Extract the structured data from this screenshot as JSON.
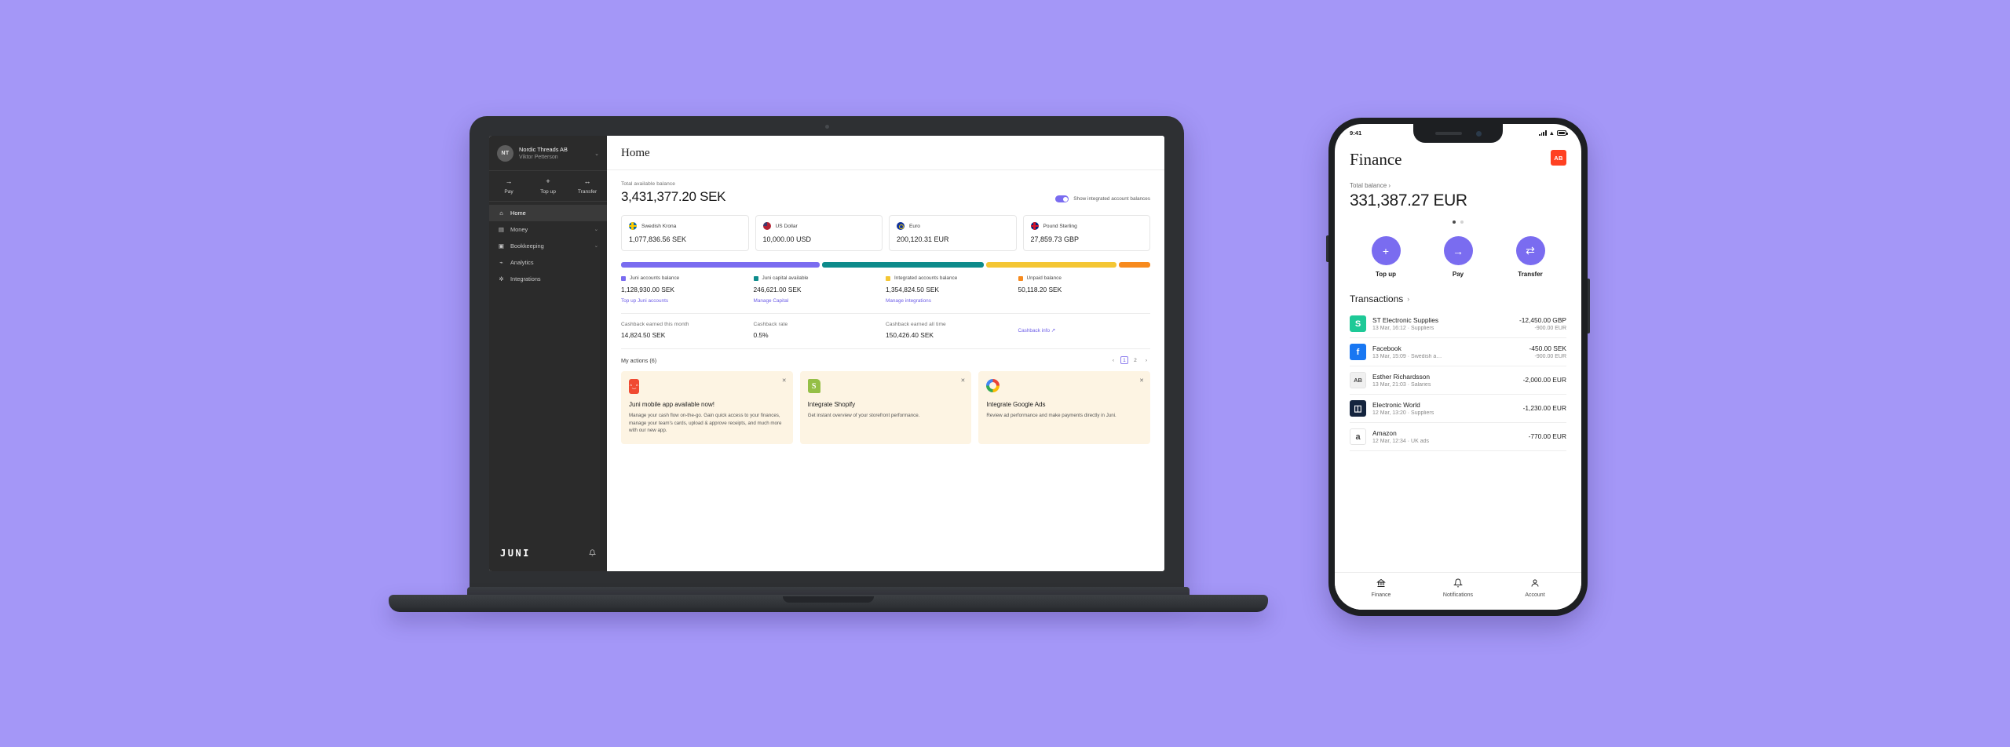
{
  "desktop": {
    "sidebar": {
      "org_initials": "NT",
      "org_name": "Nordic Threads AB",
      "user_name": "Viktor Petterson",
      "chevron": "⌄",
      "quick_actions": [
        {
          "icon": "→",
          "label": "Pay"
        },
        {
          "icon": "+",
          "label": "Top up"
        },
        {
          "icon": "↔",
          "label": "Transfer"
        }
      ],
      "nav": [
        {
          "icon": "⌂",
          "label": "Home",
          "active": true,
          "chevron": ""
        },
        {
          "icon": "▤",
          "label": "Money",
          "active": false,
          "chevron": "⌄"
        },
        {
          "icon": "▣",
          "label": "Bookkeeping",
          "active": false,
          "chevron": "⌄"
        },
        {
          "icon": "⌁",
          "label": "Analytics",
          "active": false,
          "chevron": ""
        },
        {
          "icon": "✲",
          "label": "Integrations",
          "active": false,
          "chevron": ""
        }
      ],
      "logo": "JUNI",
      "bell": "🔔"
    },
    "header": {
      "title": "Home"
    },
    "balance": {
      "label": "Total available balance",
      "amount": "3,431,377.20 SEK",
      "toggle_label": "Show integrated account balances",
      "toggle_on": true
    },
    "currencies": [
      {
        "flag": "se",
        "name": "Swedish Krona",
        "amount": "1,077,836.56 SEK"
      },
      {
        "flag": "us",
        "name": "US Dollar",
        "amount": "10,000.00 USD"
      },
      {
        "flag": "eu",
        "name": "Euro",
        "amount": "200,120.31 EUR"
      },
      {
        "flag": "gb",
        "name": "Pound Sterling",
        "amount": "27,859.73 GBP"
      }
    ],
    "breakdown": [
      {
        "label": "Juni accounts balance",
        "amount": "1,128,930.00 SEK",
        "link": "Top up Juni accounts",
        "color": "#7a6cf0",
        "weight": 38
      },
      {
        "label": "Juni capital available",
        "amount": "246,621.00 SEK",
        "link": "Manage Capital",
        "color": "#0d8b8b",
        "weight": 31
      },
      {
        "label": "Integrated accounts balance",
        "amount": "1,354,824.50 SEK",
        "link": "Manage integrations",
        "color": "#f4c634",
        "weight": 25
      },
      {
        "label": "Unpaid balance",
        "amount": "50,118.20 SEK",
        "link": "",
        "color": "#f78a1e",
        "weight": 6
      }
    ],
    "cashback": {
      "items": [
        {
          "label": "Cashback earned this month",
          "amount": "14,824.50 SEK"
        },
        {
          "label": "Cashback rate",
          "amount": "0.5%"
        },
        {
          "label": "Cashback earned all time",
          "amount": "150,426.40 SEK"
        }
      ],
      "info_link": "Cashback info ↗"
    },
    "actions": {
      "title": "My actions (6)",
      "pager": {
        "prev": "‹",
        "pages": [
          "1",
          "2"
        ],
        "current": "1",
        "next": "›"
      },
      "cards": [
        {
          "icon": "juni-app-icon",
          "title": "Juni mobile app available now!",
          "desc": "Manage your cash flow on-the-go. Gain quick access to your finances, manage your team's cards, upload & approve receipts, and much more with our new app.",
          "close": "✕"
        },
        {
          "icon": "shopify-icon",
          "title": "Integrate Shopify",
          "desc": "Get instant overview of your storefront performance.",
          "close": "✕"
        },
        {
          "icon": "google-icon",
          "title": "Integrate Google Ads",
          "desc": "Review ad performance and make payments directly in Juni.",
          "close": "✕"
        }
      ]
    }
  },
  "mobile": {
    "status": {
      "time": "9:41"
    },
    "header": {
      "title": "Finance",
      "badge": "AB"
    },
    "balance": {
      "label": "Total balance ›",
      "amount": "331,387.27 EUR",
      "dots": 2,
      "active_dot": 0
    },
    "actions": [
      {
        "icon": "+",
        "label": "Top up"
      },
      {
        "icon": "→",
        "label": "Pay"
      },
      {
        "icon": "⇄",
        "label": "Transfer"
      }
    ],
    "transactions": {
      "title": "Transactions",
      "chevron": "›",
      "items": [
        {
          "avatar": "S",
          "avatar_color": "#1ec997",
          "name": "ST Electronic Supplies",
          "meta": "13 Mar, 16:12 · Suppliers",
          "amount": "-12,450.00 GBP",
          "sub": "-900.00 EUR"
        },
        {
          "avatar": "f",
          "avatar_color": "#1877f2",
          "name": "Facebook",
          "meta": "13 Mar, 15:09 · Swedish a…",
          "amount": "-450.00 SEK",
          "sub": "-900.00 EUR"
        },
        {
          "avatar": "AB",
          "avatar_color": "#f0f0f0",
          "name": "Esther Richardsson",
          "meta": "13 Mar, 21:03 · Salaries",
          "amount": "-2,000.00 EUR",
          "sub": ""
        },
        {
          "avatar": "◫",
          "avatar_color": "#14243e",
          "name": "Electronic World",
          "meta": "12 Mar, 13:20 · Suppliers",
          "amount": "-1,230.00 EUR",
          "sub": ""
        },
        {
          "avatar": "a",
          "avatar_color": "#ffffff",
          "name": "Amazon",
          "meta": "12 Mar, 12:34 · UK ads",
          "amount": "-770.00 EUR",
          "sub": ""
        }
      ]
    },
    "tabs": [
      {
        "icon": "🏛",
        "label": "Finance"
      },
      {
        "icon": "🔔",
        "label": "Notifications"
      },
      {
        "icon": "👤",
        "label": "Account"
      }
    ]
  }
}
